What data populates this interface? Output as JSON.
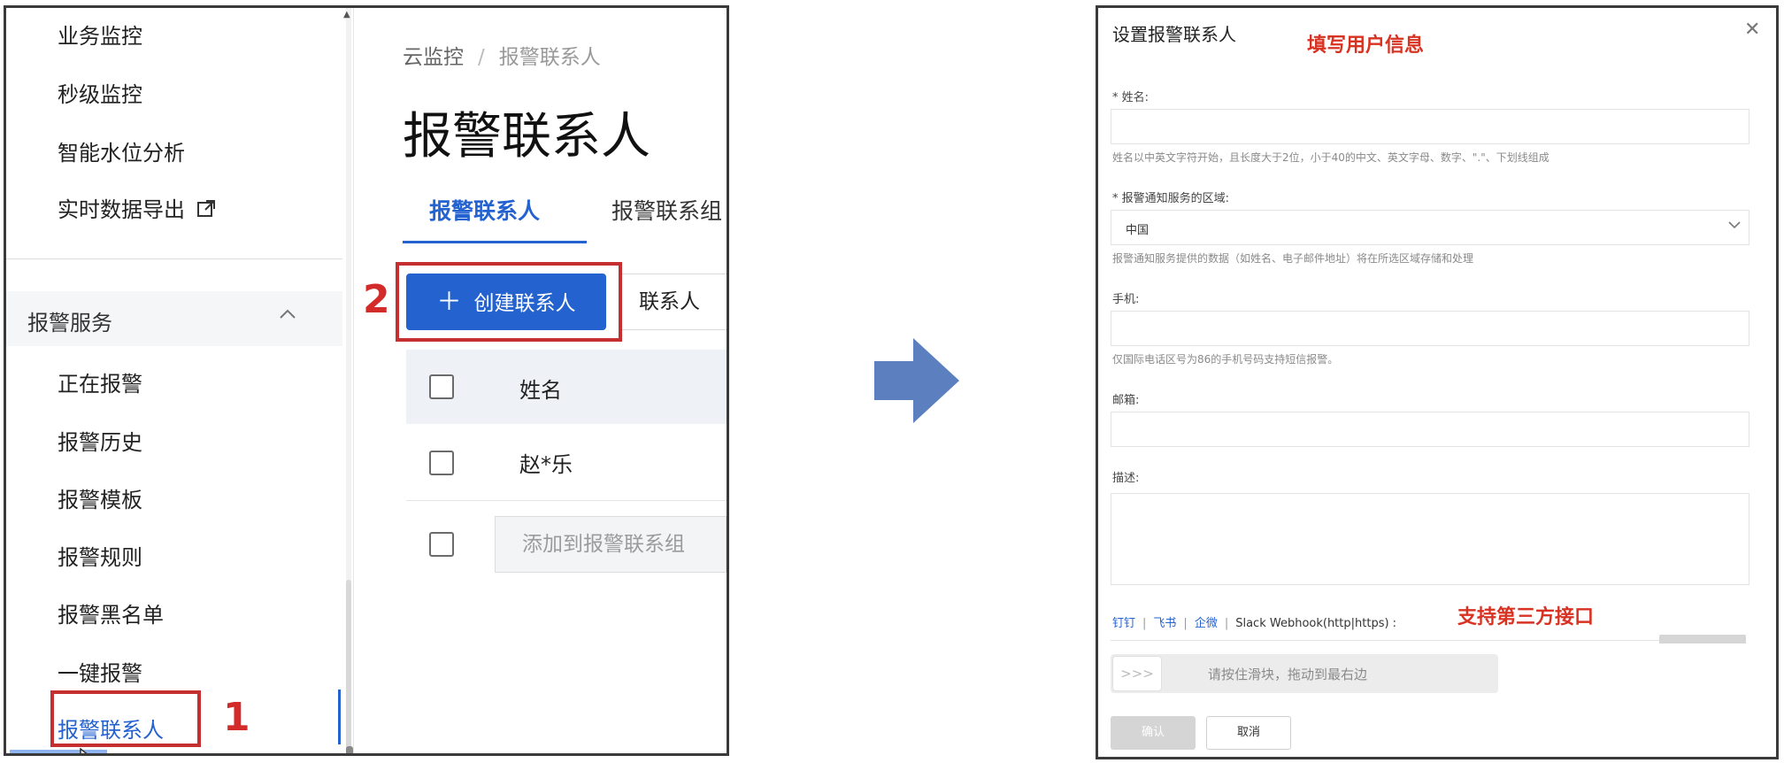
{
  "left": {
    "sidebar": {
      "items_top": [
        "业务监控",
        "秒级监控",
        "智能水位分析",
        "实时数据导出"
      ],
      "group_label": "报警服务",
      "group_items": [
        "正在报警",
        "报警历史",
        "报警模板",
        "报警规则",
        "报警黑名单",
        "一键报警",
        "报警联系人"
      ]
    },
    "main": {
      "breadcrumb_root": "云监控",
      "breadcrumb_sep": "/",
      "breadcrumb_current": "报警联系人",
      "title": "报警联系人",
      "tabs": [
        "报警联系人",
        "报警联系组"
      ],
      "create_button": "创建联系人",
      "search_label": "联系人",
      "table_header_name": "姓名",
      "table_rows": [
        "赵*乐"
      ],
      "add_to_group_button": "添加到报警联系组"
    },
    "annotations": {
      "step1": "1",
      "step2": "2"
    }
  },
  "right": {
    "dialog_title": "设置报警联系人",
    "annotation_fill": "填写用户信息",
    "annotation_third_party": "支持第三方接口",
    "fields": {
      "name_label": "* 姓名:",
      "name_help": "姓名以中英文字符开始，且长度大于2位，小于40的中文、英文字母、数字、\".\"、下划线组成",
      "region_label": "* 报警通知服务的区域:",
      "region_value": "中国",
      "region_help": "报警通知服务提供的数据（如姓名、电子邮件地址）将在所选区域存储和处理",
      "phone_label": "手机:",
      "phone_help": "仅国际电话区号为86的手机号码支持短信报警。",
      "email_label": "邮箱:",
      "desc_label": "描述:"
    },
    "integrations": {
      "dingtalk": "钉钉",
      "feishu": "飞书",
      "wecom": "企微",
      "slack": "Slack Webhook(http|https) :"
    },
    "slider": {
      "handle": ">>>",
      "text": "请按住滑块，拖动到最右边"
    },
    "buttons": {
      "ok": "确认",
      "cancel": "取消"
    }
  },
  "colors": {
    "accent": "#2462d0",
    "annotation_red": "#d83222",
    "arrow": "#5b7fbf"
  }
}
